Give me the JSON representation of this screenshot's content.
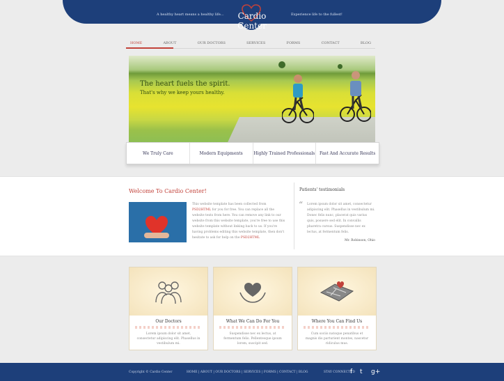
{
  "header": {
    "brand": "Cardio Center",
    "tagline_left": "A healthy heart means a healthy life...",
    "tagline_right": "Experience life to the fullest!"
  },
  "nav": {
    "items": [
      {
        "label": "HOME",
        "active": true
      },
      {
        "label": "ABOUT",
        "active": false
      },
      {
        "label": "OUR DOCTORS",
        "active": false
      },
      {
        "label": "SERVICES",
        "active": false
      },
      {
        "label": "FORMS",
        "active": false
      },
      {
        "label": "CONTACT",
        "active": false
      },
      {
        "label": "BLOG",
        "active": false
      }
    ]
  },
  "hero": {
    "title": "The heart fuels the spirit.",
    "subtitle": "That's why we keep yours healthy."
  },
  "features": {
    "items": [
      {
        "label": "We Truly Care"
      },
      {
        "label": "Modern Equipments"
      },
      {
        "label": "Highly Trained Professionals"
      },
      {
        "label": "Fast And Accurate Results"
      }
    ]
  },
  "welcome": {
    "title": "Welcome To Cardio Center!",
    "text_before": "This website template has been collected from",
    "link_text": "PSD2HTML",
    "text_middle": "for you for free. You can replace all the website texts from here. You can remove any link to our website from this website template, you're free to use this website template without linking back to us. If you're having problems editing this website template, then don't hesitate to ask for help on the",
    "link_text_2": "PSD2HTML"
  },
  "testimonials": {
    "title": "Patients' testimonials",
    "quote": "Lorem ipsum dolor sit amet, consectetur adipiscing elit. Phasellus in vestibulum mi. Donec felis nunc, placerat quis varius quis, posuere sed elit. In convallis pharetra cursus. Suspendisse nec ex lectus, at fermentum felis.",
    "author": "Mr. Robinson, Ohio"
  },
  "cards": [
    {
      "title": "Our Doctors",
      "text": "Lorem ipsum dolor sit amet, consectetur adipiscing elit. Phasellus in vestibulum mi."
    },
    {
      "title": "What We Can Do For You",
      "text": "Suspendisse nec ex lectus, at fermentum felis. Pellentesque ipsum lorem, suscipit sed."
    },
    {
      "title": "Where You Can Find Us",
      "text": "Cum sociis natoque penatibus et magnis dis parturient montes, nascetur ridiculus mus."
    }
  ],
  "footer": {
    "copyright": "Copyright © Cardio Center",
    "links": "HOME | ABOUT | OUR DOCTORS | SERVICES | FORMS | CONTACT | BLOG",
    "stay_connected": "STAY CONNECTED",
    "social": [
      {
        "icon": "facebook-icon",
        "glyph": "f"
      },
      {
        "icon": "twitter-icon",
        "glyph": "t"
      },
      {
        "icon": "googleplus-icon",
        "glyph": "g+"
      }
    ]
  },
  "colors": {
    "brand_blue": "#1d3f7a",
    "accent_red": "#c2423a"
  }
}
